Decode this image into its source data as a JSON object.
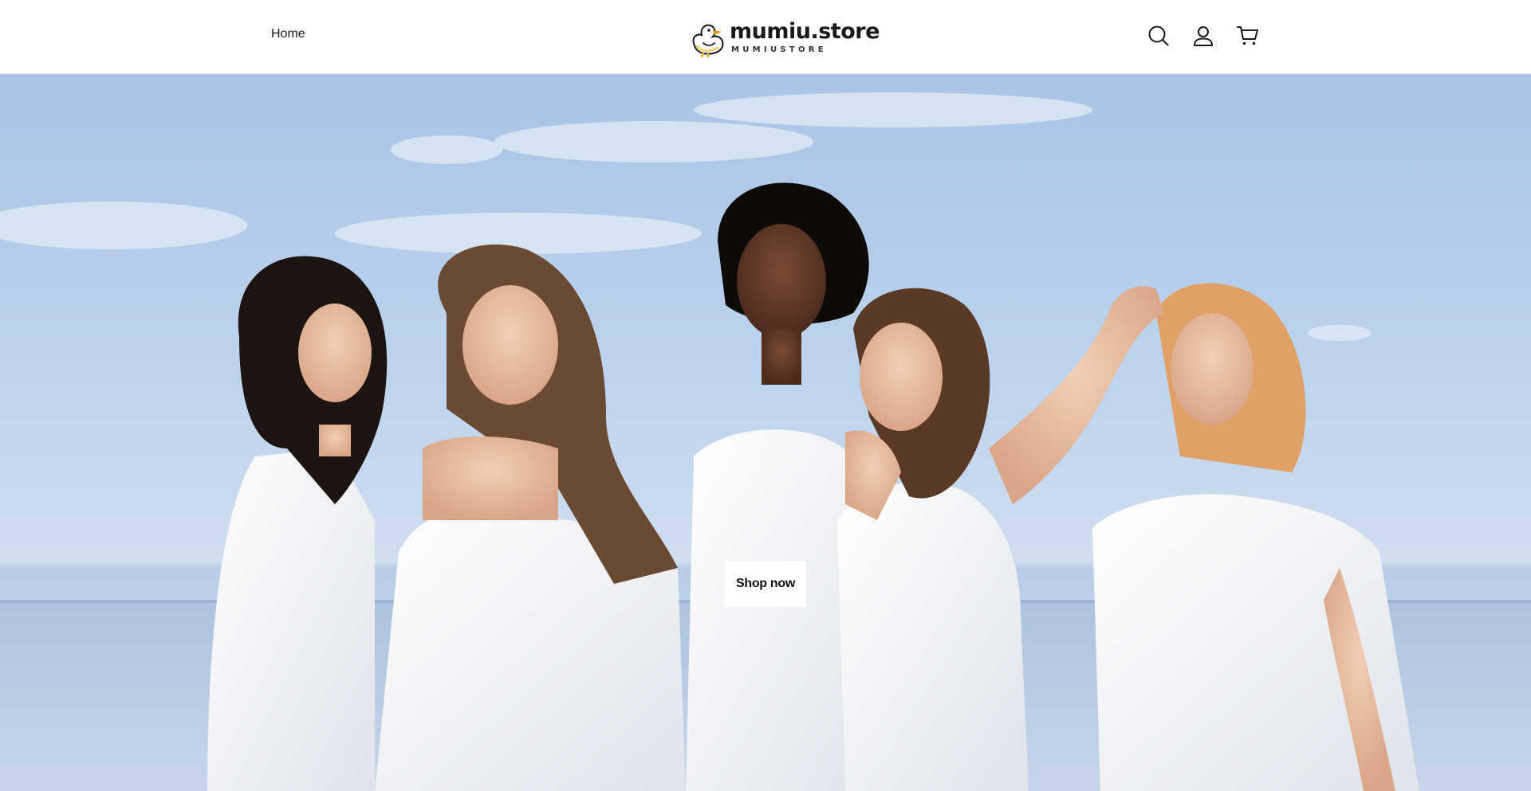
{
  "header": {
    "nav": {
      "home_label": "Home"
    },
    "logo": {
      "main": "mumiu.store",
      "sub": "MUMIUSTORE",
      "icon": "duck-icon"
    },
    "icons": {
      "search": "search-icon",
      "account": "user-icon",
      "cart": "cart-icon"
    }
  },
  "hero": {
    "cta_label": "Shop now",
    "image_description_icon": "hero-photo"
  },
  "colors": {
    "header_bg": "#ffffff",
    "text": "#121212",
    "button_bg": "#ffffff",
    "logo_duck": "#f4a21c",
    "sky": "#b7cfec"
  }
}
